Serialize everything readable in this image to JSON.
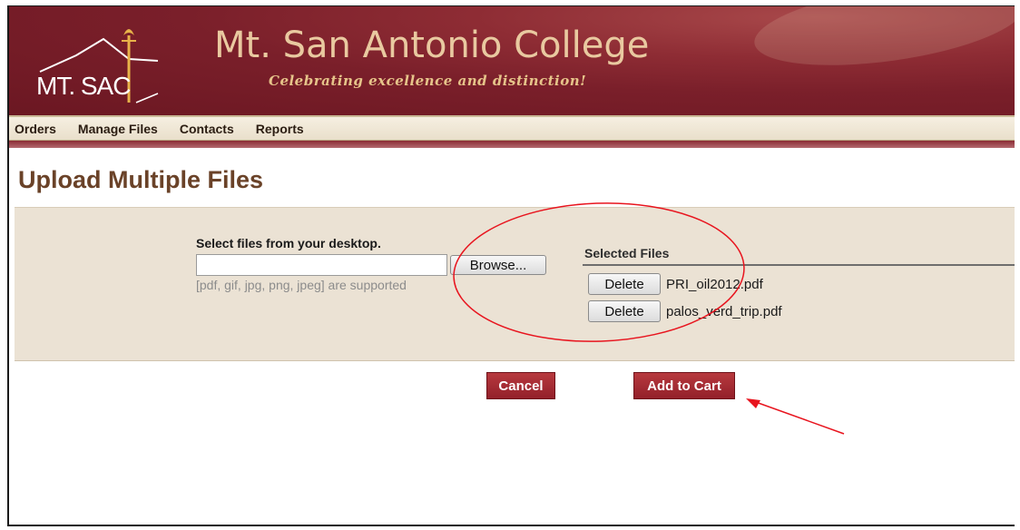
{
  "header": {
    "logo_text": "MT. SAC",
    "college_name": "Mt. San Antonio College",
    "tagline": "Celebrating excellence and distinction!"
  },
  "nav": {
    "items": [
      {
        "label": "Orders"
      },
      {
        "label": "Manage Files"
      },
      {
        "label": "Contacts"
      },
      {
        "label": "Reports"
      }
    ]
  },
  "page": {
    "title": "Upload Multiple Files"
  },
  "upload": {
    "select_label": "Select files from your desktop.",
    "file_input_value": "",
    "browse_label": "Browse...",
    "supported_text": "[pdf, gif, jpg, png, jpeg] are supported"
  },
  "selected_files": {
    "title": "Selected Files",
    "delete_label": "Delete",
    "files": [
      {
        "name": "PRI_oil2012.pdf"
      },
      {
        "name": "palos_verd_trip.pdf"
      }
    ]
  },
  "actions": {
    "cancel_label": "Cancel",
    "add_to_cart_label": "Add to Cart"
  },
  "colors": {
    "banner": "#7a1f2a",
    "title": "#6a4228",
    "panel": "#ebe2d4",
    "action_button": "#a22c33",
    "annotation": "#e8141e"
  }
}
